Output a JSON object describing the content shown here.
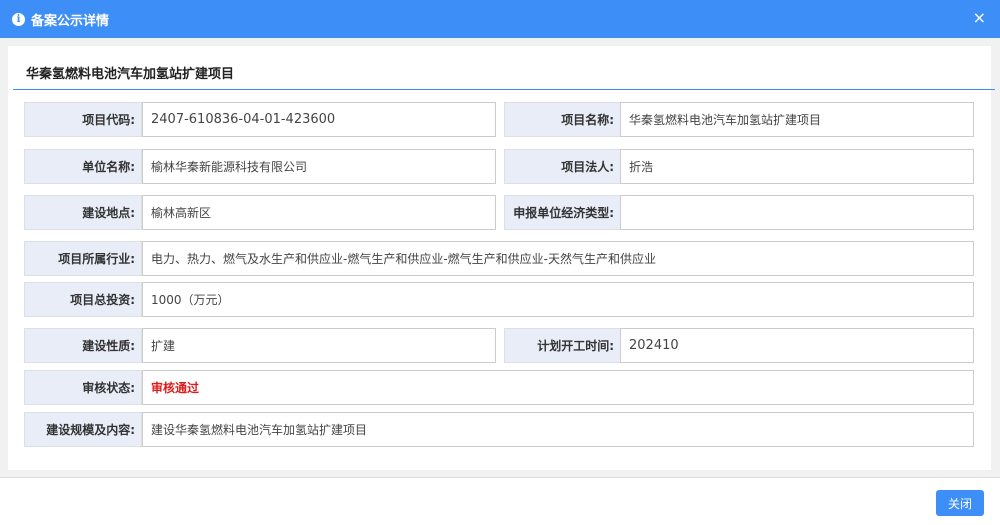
{
  "dialog": {
    "title": "备案公示详情",
    "info_icon": "i",
    "close_icon": "×"
  },
  "project_title": "华秦氢燃料电池汽车加氢站扩建项目",
  "fields": {
    "project_code": {
      "label": "项目代码:",
      "value": "2407-610836-04-01-423600"
    },
    "project_name": {
      "label": "项目名称:",
      "value": "华秦氢燃料电池汽车加氢站扩建项目"
    },
    "company": {
      "label": "单位名称:",
      "value": "榆林华秦新能源科技有限公司"
    },
    "legal_person": {
      "label": "项目法人:",
      "value": "折浩"
    },
    "location": {
      "label": "建设地点:",
      "value": "榆林高新区"
    },
    "economic_type": {
      "label": "申报单位经济类型:",
      "value": ""
    },
    "industry": {
      "label": "项目所属行业:",
      "value": "电力、热力、燃气及水生产和供应业-燃气生产和供应业-燃气生产和供应业-天然气生产和供应业"
    },
    "investment": {
      "label": "项目总投资:",
      "value": "1000（万元）"
    },
    "nature": {
      "label": "建设性质:",
      "value": "扩建"
    },
    "start_time": {
      "label": "计划开工时间:",
      "value": "202410"
    },
    "review_status": {
      "label": "审核状态:",
      "value": "审核通过"
    },
    "scale": {
      "label": "建设规模及内容:",
      "value": "建设华秦氢燃料电池汽车加氢站扩建项目"
    }
  },
  "footer": {
    "close_label": "关闭"
  },
  "colors": {
    "accent": "#3e8ef7",
    "status_approved": "#e01b1b",
    "label_bg": "#e9edf8"
  }
}
